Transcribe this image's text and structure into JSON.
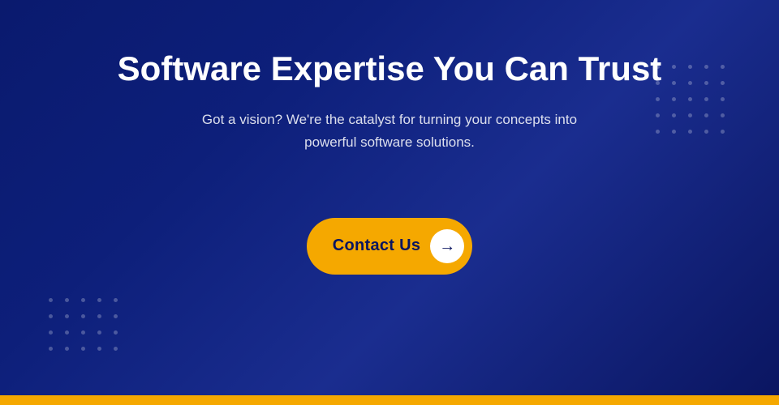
{
  "hero": {
    "title": "Software Expertise You Can Trust",
    "subtitle": "Got a vision? We're the catalyst for turning your concepts into powerful software solutions.",
    "cta_label": "Contact Us",
    "cta_arrow": "→"
  },
  "colors": {
    "background_start": "#0a1a6e",
    "background_end": "#0a1560",
    "gold": "#f5a800",
    "white": "#ffffff",
    "text_dark": "#0a1560"
  },
  "dots": {
    "count": 25
  }
}
